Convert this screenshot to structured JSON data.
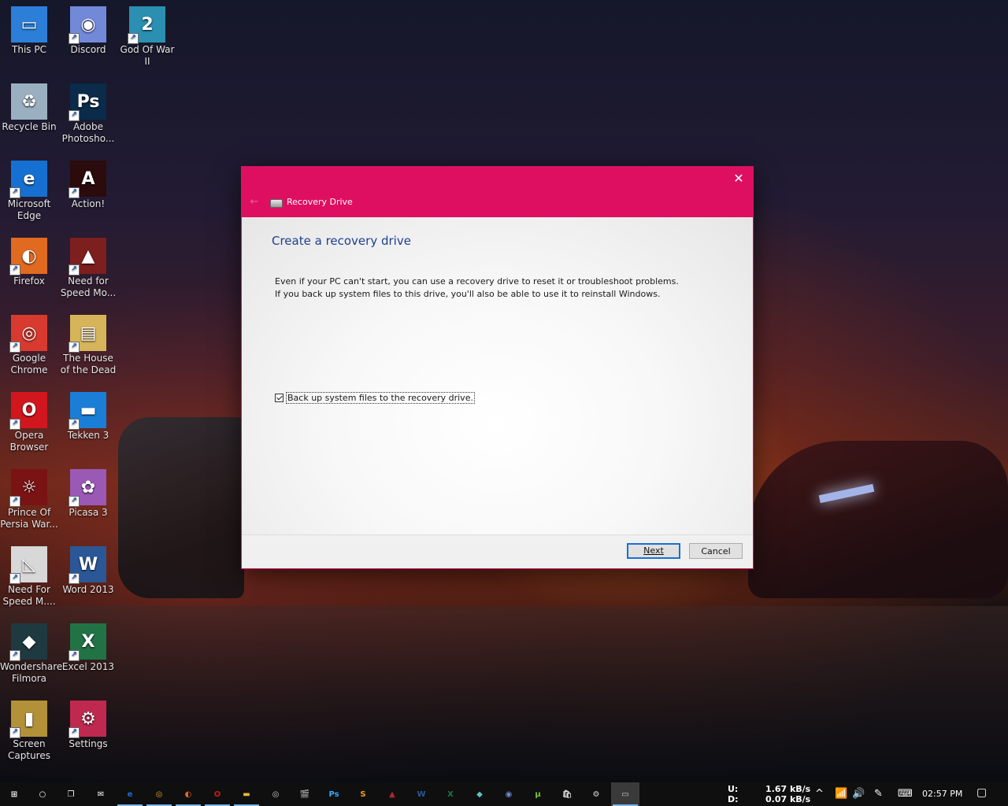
{
  "desktop": {
    "icons": [
      {
        "label": "This PC",
        "glyph": "▭",
        "color": "#2c7fd9"
      },
      {
        "label": "Discord",
        "glyph": "◉",
        "color": "#7289da"
      },
      {
        "label": "God Of War II",
        "glyph": "2",
        "color": "#2a8fb0"
      },
      {
        "label": "Recycle Bin",
        "glyph": "♻",
        "color": "#9ab0c0"
      },
      {
        "label": "Adobe Photosho...",
        "glyph": "Ps",
        "color": "#0b2b4a"
      },
      {
        "label": "Microsoft Edge",
        "glyph": "e",
        "color": "#1570d1"
      },
      {
        "label": "Action!",
        "glyph": "A",
        "color": "#2b0b0b"
      },
      {
        "label": "Firefox",
        "glyph": "◐",
        "color": "#e06a1f"
      },
      {
        "label": "Need for Speed Mo...",
        "glyph": "▲",
        "color": "#7d1f1f"
      },
      {
        "label": "Google Chrome",
        "glyph": "◎",
        "color": "#d83a2f"
      },
      {
        "label": "The House of the Dead",
        "glyph": "▤",
        "color": "#d6b45a"
      },
      {
        "label": "Opera Browser",
        "glyph": "O",
        "color": "#d2161d"
      },
      {
        "label": "Tekken 3",
        "glyph": "▬",
        "color": "#1b7ed6"
      },
      {
        "label": "Prince Of Persia War...",
        "glyph": "☼",
        "color": "#7a1313"
      },
      {
        "label": "Picasa 3",
        "glyph": "✿",
        "color": "#9b59b6"
      },
      {
        "label": "Need For Speed M....",
        "glyph": "◺",
        "color": "#d8d8d8"
      },
      {
        "label": "Word 2013",
        "glyph": "W",
        "color": "#2b5797"
      },
      {
        "label": "Wondershare Filmora",
        "glyph": "◆",
        "color": "#1f3940"
      },
      {
        "label": "Excel 2013",
        "glyph": "X",
        "color": "#217346"
      },
      {
        "label": "Screen Captures",
        "glyph": "▮",
        "color": "#b39138"
      },
      {
        "label": "Settings",
        "glyph": "⚙",
        "color": "#c0294f"
      }
    ]
  },
  "dialog": {
    "title": "Recovery Drive",
    "close_glyph": "✕",
    "back_glyph": "←",
    "heading": "Create a recovery drive",
    "description": "Even if your PC can't start, you can use a recovery drive to reset it or troubleshoot problems. If you back up system files to this drive, you'll also be able to use it to reinstall Windows.",
    "checkbox_label": "Back up system files to the recovery drive.",
    "checkbox_checked": true,
    "next_label": "Next",
    "cancel_label": "Cancel",
    "accent": "#de0f60"
  },
  "taskbar": {
    "items": [
      {
        "name": "start",
        "glyph": "⊞",
        "color": "#ffffff"
      },
      {
        "name": "search",
        "glyph": "○",
        "color": "#ffffff"
      },
      {
        "name": "task-view",
        "glyph": "❐",
        "color": "#ffffff"
      },
      {
        "name": "mail",
        "glyph": "✉",
        "color": "#ffffff"
      },
      {
        "name": "edge",
        "glyph": "e",
        "color": "#1570d1"
      },
      {
        "name": "chrome",
        "glyph": "◎",
        "color": "#e0a02f"
      },
      {
        "name": "firefox",
        "glyph": "◐",
        "color": "#e06a1f"
      },
      {
        "name": "opera",
        "glyph": "O",
        "color": "#d2161d"
      },
      {
        "name": "file-explorer",
        "glyph": "▬",
        "color": "#e8b939"
      },
      {
        "name": "media",
        "glyph": "◎",
        "color": "#cccccc"
      },
      {
        "name": "clapper",
        "glyph": "🎬",
        "color": "#dddddd"
      },
      {
        "name": "photoshop",
        "glyph": "Ps",
        "color": "#31a8ff"
      },
      {
        "name": "sublime",
        "glyph": "S",
        "color": "#f59c1c"
      },
      {
        "name": "game",
        "glyph": "▲",
        "color": "#b02a2a"
      },
      {
        "name": "word",
        "glyph": "W",
        "color": "#2b5797"
      },
      {
        "name": "excel",
        "glyph": "X",
        "color": "#217346"
      },
      {
        "name": "filmora",
        "glyph": "◆",
        "color": "#5ec3c8"
      },
      {
        "name": "discord",
        "glyph": "◉",
        "color": "#7289da"
      },
      {
        "name": "utorrent",
        "glyph": "μ",
        "color": "#78c83a"
      },
      {
        "name": "store",
        "glyph": "🛍",
        "color": "#dddddd"
      },
      {
        "name": "settings",
        "glyph": "⚙",
        "color": "#dddddd"
      },
      {
        "name": "recovery-drive",
        "glyph": "▭",
        "color": "#cccccc"
      }
    ],
    "net_labels": [
      "U:",
      "D:"
    ],
    "upload": "1.67 kB/s",
    "download": "0.07 kB/s",
    "tray_icons": [
      "^",
      "📶",
      "🔊",
      "✎",
      "⌨"
    ],
    "clock": "02:57 PM",
    "notification_glyph": "▢"
  }
}
